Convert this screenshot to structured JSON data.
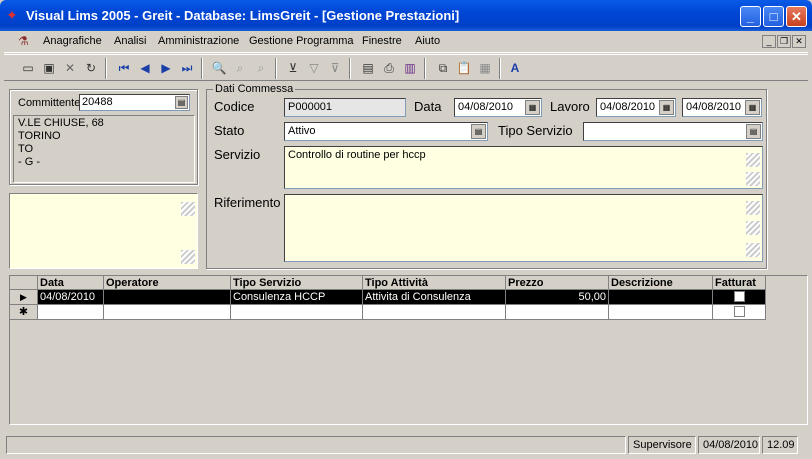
{
  "window": {
    "title": "Visual Lims 2005 - Greit - Database: LimsGreit - [Gestione Prestazioni]",
    "minimize": "_",
    "maximize": "□",
    "close": "✕"
  },
  "menu": [
    "Anagrafiche",
    "Analisi",
    "Amministrazione",
    "Gestione Programma",
    "Finestre",
    "Aiuto"
  ],
  "mdi": {
    "minimize": "_",
    "restore": "❐",
    "close": "✕"
  },
  "client": {
    "label": "Committente",
    "value": "20488",
    "address": [
      "V.LE CHIUSE, 68",
      "TORINO",
      "TO",
      " - G -"
    ]
  },
  "commessa": {
    "title": "Dati Commessa",
    "codice_label": "Codice",
    "codice": "P000001",
    "data_label": "Data",
    "data": "04/08/2010",
    "lavoro_label": "Lavoro",
    "lavoro_from": "04/08/2010",
    "lavoro_to": "04/08/2010",
    "stato_label": "Stato",
    "stato": "Attivo",
    "tipo_servizio_label": "Tipo Servizio",
    "tipo_servizio": "",
    "servizio_label": "Servizio",
    "servizio": "Controllo di routine per hccp",
    "riferimento_label": "Riferimento",
    "riferimento": ""
  },
  "grid": {
    "columns": [
      "Data",
      "Operatore",
      "Tipo Servizio",
      "Tipo Attività",
      "Prezzo",
      "Descrizione",
      "Fatturat"
    ],
    "rows": [
      {
        "data": "04/08/2010",
        "operatore": "",
        "tipo_servizio": "Consulenza HCCP",
        "tipo_attivita": "Attivita di Consulenza",
        "prezzo": "50,00",
        "descrizione": "",
        "fatturato": false
      }
    ],
    "current_marker": "▶",
    "new_marker": "✱"
  },
  "status": {
    "user": "Supervisore",
    "date": "04/08/2010",
    "time": "12.09"
  },
  "icons": {
    "lookup": "list-icon",
    "calendar": "calendar-icon"
  }
}
